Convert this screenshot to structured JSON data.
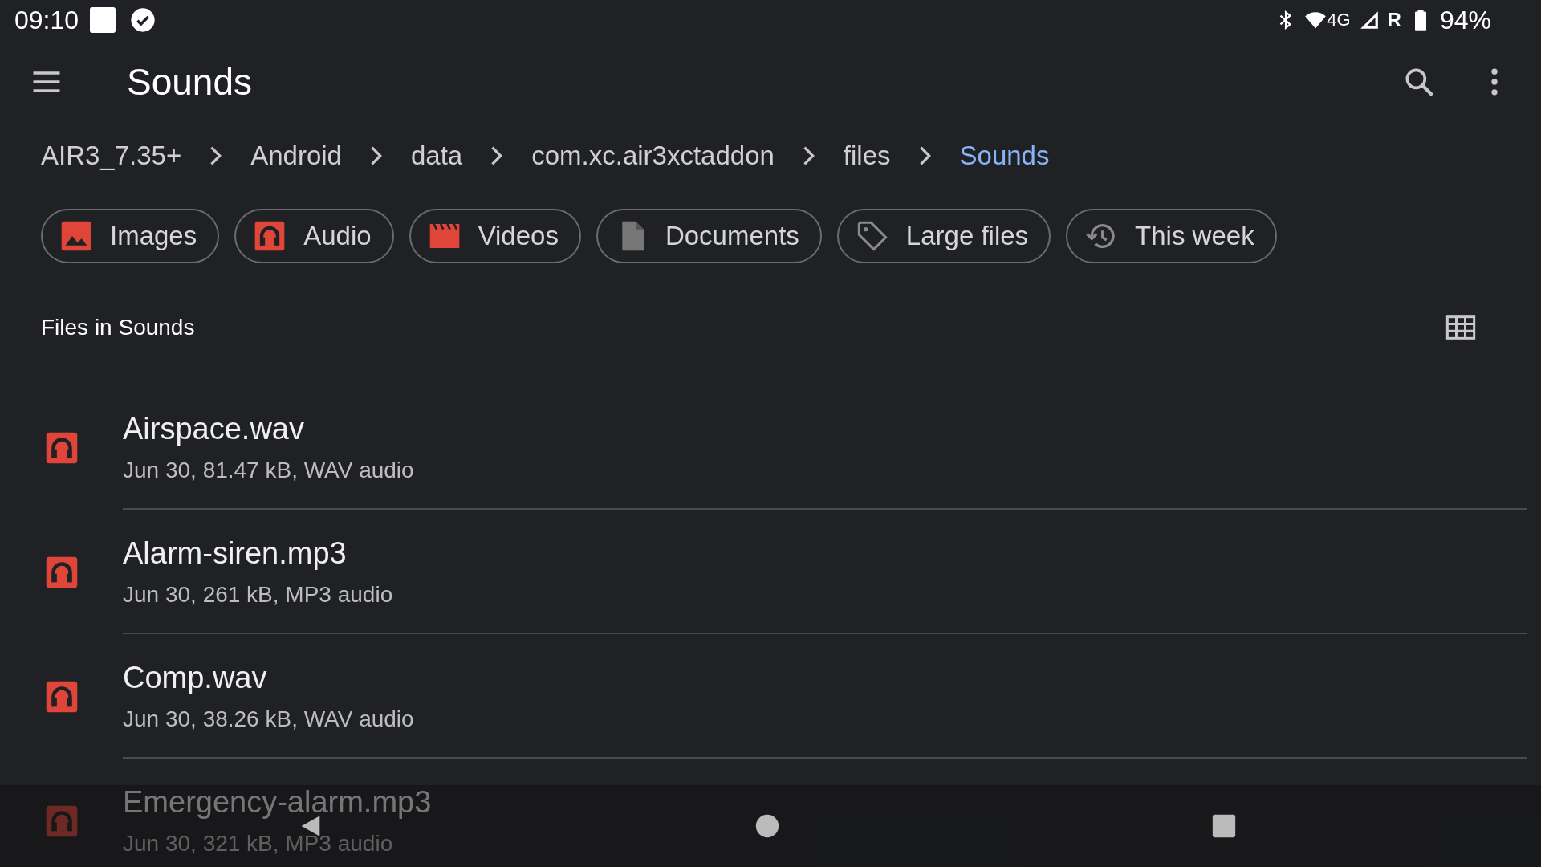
{
  "status_bar": {
    "time": "09:10",
    "network": "4G",
    "roaming": "R",
    "battery": "94%"
  },
  "app_bar": {
    "title": "Sounds"
  },
  "breadcrumbs": [
    {
      "label": "AIR3_7.35+",
      "selected": false
    },
    {
      "label": "Android",
      "selected": false
    },
    {
      "label": "data",
      "selected": false
    },
    {
      "label": "com.xc.air3xctaddon",
      "selected": false
    },
    {
      "label": "files",
      "selected": false
    },
    {
      "label": "Sounds",
      "selected": true
    }
  ],
  "chips": [
    {
      "label": "Images",
      "kind": "images"
    },
    {
      "label": "Audio",
      "kind": "audio"
    },
    {
      "label": "Videos",
      "kind": "videos"
    },
    {
      "label": "Documents",
      "kind": "documents"
    },
    {
      "label": "Large files",
      "kind": "large"
    },
    {
      "label": "This week",
      "kind": "recent"
    }
  ],
  "section": {
    "title": "Files in Sounds"
  },
  "files": [
    {
      "name": "Airspace.wav",
      "details": "Jun 30, 81.47 kB, WAV audio"
    },
    {
      "name": "Alarm-siren.mp3",
      "details": "Jun 30, 261 kB, MP3 audio"
    },
    {
      "name": "Comp.wav",
      "details": "Jun 30, 38.26 kB, WAV audio"
    },
    {
      "name": "Emergency-alarm.mp3",
      "details": "Jun 30, 321 kB, MP3 audio"
    }
  ]
}
